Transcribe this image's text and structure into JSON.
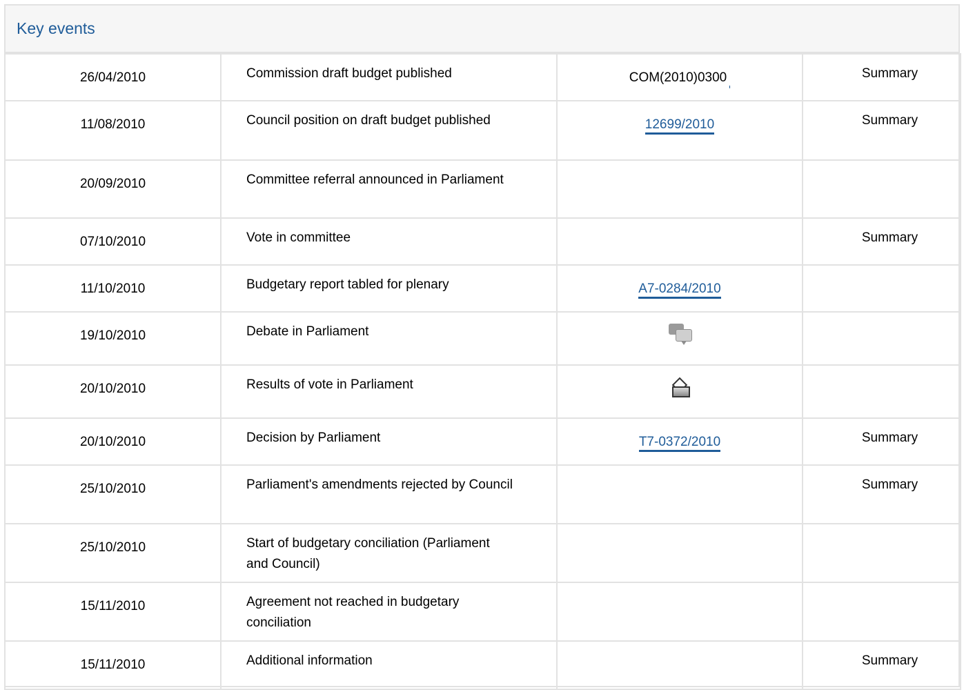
{
  "section": {
    "title": "Key events"
  },
  "rows": [
    {
      "date": "26/04/2010",
      "event": "Commission draft budget published",
      "doc": "COM(2010)0300",
      "doc_type": "text",
      "summary": "Summary"
    },
    {
      "date": "11/08/2010",
      "event": "Council position on draft budget published",
      "doc": "12699/2010",
      "doc_type": "link",
      "summary": "Summary"
    },
    {
      "date": "20/09/2010",
      "event": "Committee referral announced in Parliament",
      "doc": "",
      "doc_type": "none",
      "summary": ""
    },
    {
      "date": "07/10/2010",
      "event": "Vote in committee",
      "doc": "",
      "doc_type": "none",
      "summary": "Summary"
    },
    {
      "date": "11/10/2010",
      "event": "Budgetary report tabled for plenary",
      "doc": "A7-0284/2010",
      "doc_type": "link",
      "summary": ""
    },
    {
      "date": "19/10/2010",
      "event": "Debate in Parliament",
      "doc": "",
      "doc_type": "debate-icon",
      "summary": ""
    },
    {
      "date": "20/10/2010",
      "event": "Results of vote in Parliament",
      "doc": "",
      "doc_type": "vote-icon",
      "summary": ""
    },
    {
      "date": "20/10/2010",
      "event": "Decision by Parliament",
      "doc": "T7-0372/2010",
      "doc_type": "link",
      "summary": "Summary"
    },
    {
      "date": "25/10/2010",
      "event": "Parliament's amendments rejected by Council",
      "doc": "",
      "doc_type": "none",
      "summary": "Summary"
    },
    {
      "date": "25/10/2010",
      "event": "Start of budgetary conciliation (Parliament and Council)",
      "doc": "",
      "doc_type": "none",
      "summary": ""
    },
    {
      "date": "15/11/2010",
      "event": "Agreement not reached in budgetary conciliation",
      "doc": "",
      "doc_type": "none",
      "summary": ""
    },
    {
      "date": "15/11/2010",
      "event": "Additional information",
      "doc": "",
      "doc_type": "none",
      "summary": "Summary"
    }
  ],
  "colors": {
    "accent": "#1f5c99",
    "border": "#e2e2e2",
    "header_bg": "#f6f6f6"
  }
}
